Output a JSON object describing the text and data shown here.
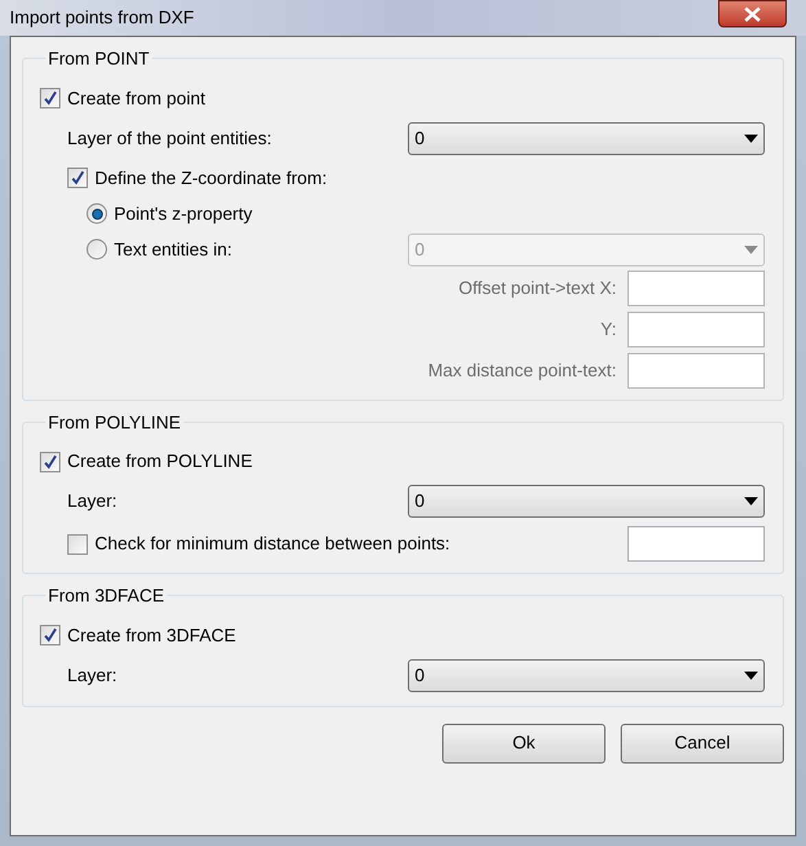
{
  "window": {
    "title": "Import points from DXF"
  },
  "sections": [
    {
      "title": "From POINT",
      "rows": [
        {
          "kind": "checkbox",
          "label": "Create from point",
          "checked": true,
          "children": [
            {
              "kind": "combo",
              "label": "Layer of the point entities:",
              "value": "0",
              "disabled": false
            },
            {
              "kind": "checkbox",
              "label": "Define the Z-coordinate from:",
              "checked": true,
              "children": [
                {
                  "kind": "radio",
                  "label": "Point's z-property",
                  "selected": true
                },
                {
                  "kind": "radio",
                  "label": "Text entities in:",
                  "selected": false,
                  "combo": {
                    "value": "0",
                    "disabled": true
                  }
                },
                {
                  "kind": "field",
                  "label": "Offset point->text X:",
                  "disabled": true
                },
                {
                  "kind": "field",
                  "label": "Y:",
                  "disabled": true
                },
                {
                  "kind": "field",
                  "label": "Max distance point-text:",
                  "disabled": true
                }
              ]
            }
          ]
        }
      ]
    },
    {
      "title": "From POLYLINE",
      "rows": [
        {
          "kind": "checkbox",
          "label": "Create from POLYLINE",
          "checked": true,
          "children": [
            {
              "kind": "combo",
              "label": "Layer:",
              "value": "0",
              "disabled": false
            },
            {
              "kind": "checkfield",
              "label": "Check for minimum distance between points:",
              "checked": false
            }
          ]
        }
      ]
    },
    {
      "title": "From 3DFACE",
      "rows": [
        {
          "kind": "checkbox",
          "label": "Create from 3DFACE",
          "checked": true,
          "children": [
            {
              "kind": "combo",
              "label": "Layer:",
              "value": "0",
              "disabled": false
            }
          ]
        }
      ]
    }
  ],
  "buttons": [
    "Ok",
    "Cancel"
  ]
}
